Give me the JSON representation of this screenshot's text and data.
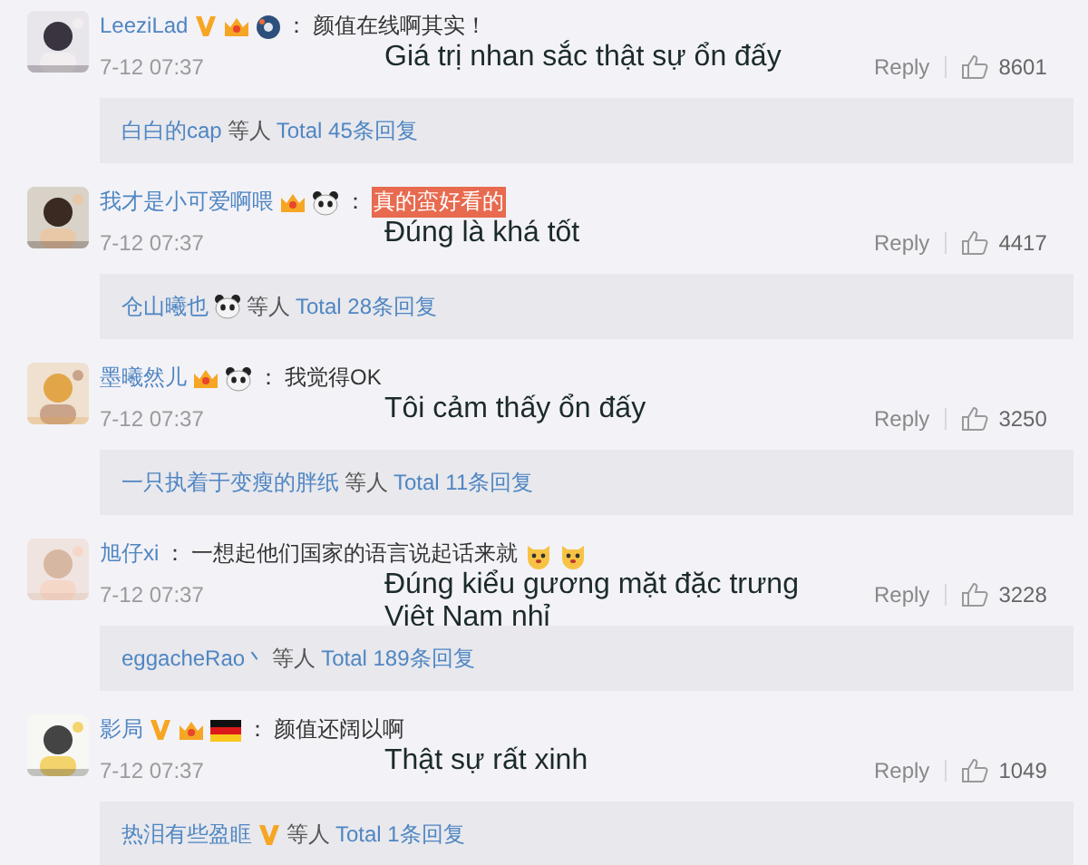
{
  "comments": [
    {
      "name": "LeeziLad",
      "badges": [
        {
          "kind": "vip"
        },
        {
          "kind": "crown"
        },
        {
          "kind": "ball"
        }
      ],
      "colon": "：",
      "text": "颜值在线啊其实！",
      "highlighted": false,
      "date": "7-12 07:37",
      "translation": "Giá trị nhan sắc thật sự ổn đấy",
      "reply": "Reply",
      "likes": "8601",
      "thread": {
        "replier": "白白的cap",
        "others": "等人",
        "total": "Total 45条回复"
      }
    },
    {
      "name": "我才是小可爱啊喂",
      "badges": [
        {
          "kind": "crown"
        },
        {
          "kind": "panda"
        }
      ],
      "colon": "：",
      "text": "真的蛮好看的",
      "highlighted": true,
      "date": "7-12 07:37",
      "translation": "Đúng là khá tốt",
      "reply": "Reply",
      "likes": "4417",
      "thread": {
        "replier": "仓山曦也",
        "badges": [
          {
            "kind": "panda"
          }
        ],
        "others": "等人",
        "total": "Total 28条回复"
      }
    },
    {
      "name": "墨曦然儿",
      "badges": [
        {
          "kind": "crown"
        },
        {
          "kind": "panda"
        }
      ],
      "colon": "：",
      "text": "我觉得OK",
      "highlighted": false,
      "date": "7-12 07:37",
      "translation": "Tôi cảm thấy ổn đấy",
      "reply": "Reply",
      "likes": "3250",
      "thread": {
        "replier": "一只执着于变瘦的胖纸",
        "others": "等人",
        "total": "Total 11条回复"
      }
    },
    {
      "name": "旭仔xi",
      "colon": "：",
      "text": "一想起他们国家的语言说起话来就",
      "highlighted": false,
      "emojis": [
        {
          "kind": "cat"
        },
        {
          "kind": "cat"
        }
      ],
      "date": "7-12 07:37",
      "translation": "Đúng kiểu gương mặt đặc trưng Việt Nam nhỉ",
      "reply": "Reply",
      "likes": "3228",
      "thread": {
        "replier": "eggacheRao丶",
        "others": "等人",
        "total": "Total 189条回复"
      }
    },
    {
      "name": "影局",
      "badges": [
        {
          "kind": "vip"
        },
        {
          "kind": "crown"
        },
        {
          "kind": "flag"
        }
      ],
      "colon": "：",
      "text": "颜值还阔以啊",
      "highlighted": false,
      "date": "7-12 07:37",
      "translation": "Thật sự rất xinh",
      "reply": "Reply",
      "likes": "1049",
      "thread": {
        "replier": "热泪有些盈眶",
        "badges": [
          {
            "kind": "vip"
          }
        ],
        "others": "等人",
        "total": "Total 1条回复"
      }
    }
  ]
}
